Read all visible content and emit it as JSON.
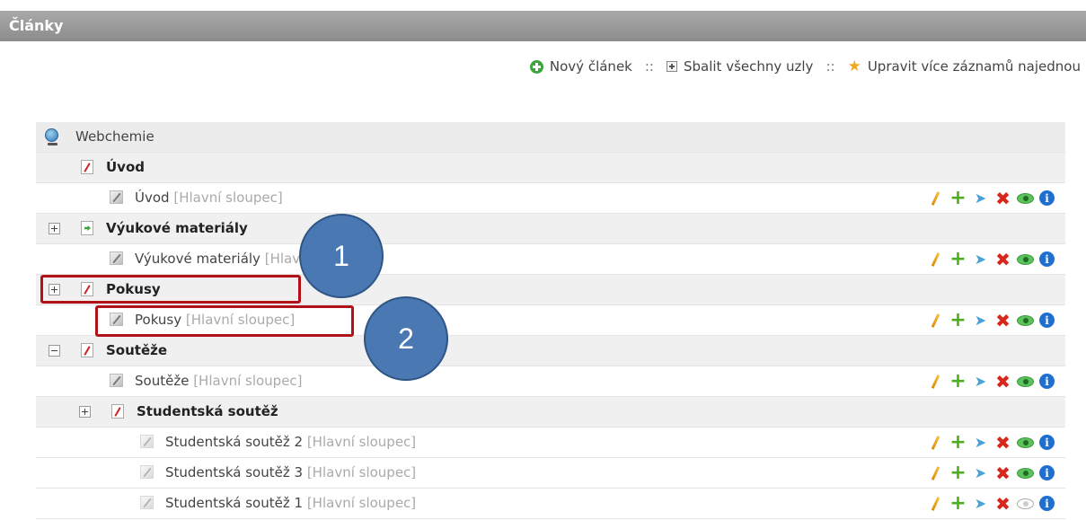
{
  "header": {
    "title": "Články"
  },
  "toolbar": {
    "new_label": "Nový článek",
    "collapse_label": "Sbalit všechny uzly",
    "edit_multi_label": "Upravit více záznamů najednou",
    "separator": "::"
  },
  "tree": {
    "root_label": "Webchemie",
    "rows": [
      {
        "title": "Úvod"
      },
      {
        "title": "Úvod",
        "column": "[Hlavní sloupec]"
      },
      {
        "title": "Výukové materiály"
      },
      {
        "title": "Výukové materiály",
        "column": "[Hlavní sloupec]"
      },
      {
        "title": "Pokusy"
      },
      {
        "title": "Pokusy",
        "column": "[Hlavní sloupec]"
      },
      {
        "title": "Soutěže"
      },
      {
        "title": "Soutěže",
        "column": "[Hlavní sloupec]"
      },
      {
        "title": "Studentská soutěž"
      },
      {
        "title": "Studentská soutěž 2",
        "column": "[Hlavní sloupec]"
      },
      {
        "title": "Studentská soutěž 3",
        "column": "[Hlavní sloupec]"
      },
      {
        "title": "Studentská soutěž 1",
        "column": "[Hlavní sloupec]"
      }
    ]
  },
  "actions": {
    "info_glyph": "i"
  },
  "callouts": {
    "first": "1",
    "second": "2"
  },
  "colors": {
    "highlight": "#b01218",
    "callout": "#4a78b3",
    "header_bg": "#9a9a9a"
  }
}
